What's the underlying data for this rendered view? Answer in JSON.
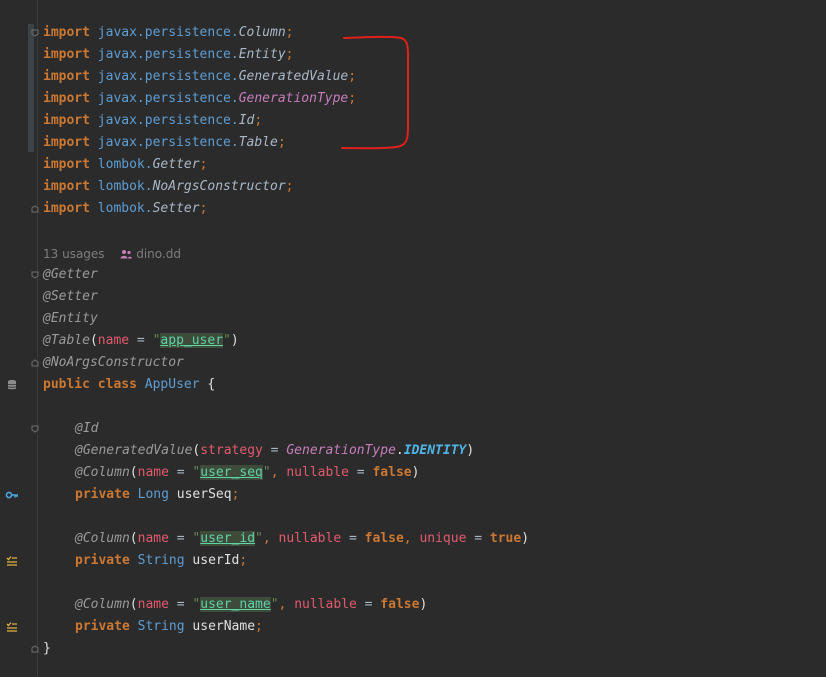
{
  "imports": [
    {
      "keyword": "import",
      "pkg": "javax.persistence.",
      "cls": "Column"
    },
    {
      "keyword": "import",
      "pkg": "javax.persistence.",
      "cls": "Entity"
    },
    {
      "keyword": "import",
      "pkg": "javax.persistence.",
      "cls": "GeneratedValue"
    },
    {
      "keyword": "import",
      "pkg": "javax.persistence.",
      "cls": "GenerationType"
    },
    {
      "keyword": "import",
      "pkg": "javax.persistence.",
      "cls": "Id"
    },
    {
      "keyword": "import",
      "pkg": "javax.persistence.",
      "cls": "Table"
    },
    {
      "keyword": "import",
      "pkg": "lombok.",
      "cls": "Getter"
    },
    {
      "keyword": "import",
      "pkg": "lombok.",
      "cls": "NoArgsConstructor"
    },
    {
      "keyword": "import",
      "pkg": "lombok.",
      "cls": "Setter"
    }
  ],
  "hint": {
    "usages": "13 usages",
    "author": "dino.dd"
  },
  "class_annotations": {
    "getter": "@Getter",
    "setter": "@Setter",
    "entity": "@Entity",
    "table": "@Table",
    "table_param": "name",
    "table_value": "app_user",
    "noargs": "@NoArgsConstructor"
  },
  "class_decl": {
    "public": "public",
    "class": "class",
    "name": "AppUser",
    "open": "{",
    "close": "}"
  },
  "fields": {
    "id_ann": "@Id",
    "gen_ann": "@GeneratedValue",
    "gen_param": "strategy",
    "gen_enum": "GenerationType",
    "gen_const": "IDENTITY",
    "col1_ann": "@Column",
    "col1_name": "user_seq",
    "col1_nullable_value": "false",
    "f1_mod": "private",
    "f1_type": "Long",
    "f1_name": "userSeq",
    "col2_ann": "@Column",
    "col2_name": "user_id",
    "col2_nullable_value": "false",
    "col2_unique_value": "true",
    "f2_mod": "private",
    "f2_type": "String",
    "f2_name": "userId",
    "col3_ann": "@Column",
    "col3_name": "user_name",
    "col3_nullable_value": "false",
    "f3_mod": "private",
    "f3_type": "String",
    "f3_name": "userName"
  },
  "params": {
    "name": "name",
    "nullable": "nullable",
    "unique": "unique"
  },
  "icons": {
    "db": "database-icon",
    "key": "key-icon",
    "column1": "column-icon",
    "column2": "column-icon",
    "fold": "fold-icon",
    "user": "user-icon",
    "annotation": "red-bracket-annotation"
  },
  "colors": {
    "background": "#2b2b2b",
    "keyword": "#cc7832",
    "package": "#5d9dd3",
    "string": "#6a8759",
    "annotation_mark": "#e0201a"
  }
}
